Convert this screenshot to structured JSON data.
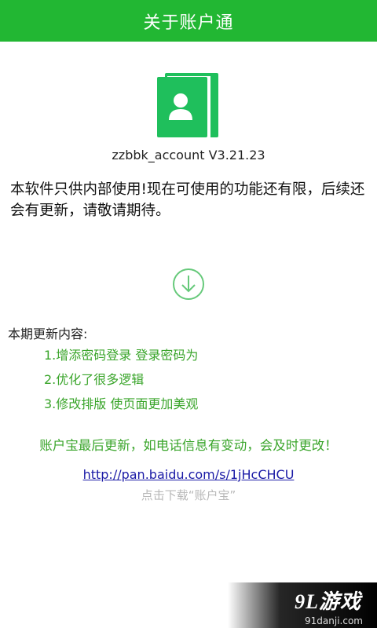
{
  "header": {
    "title": "关于账户通"
  },
  "app": {
    "icon": "contact-card-icon",
    "version": "zzbbk_account V3.21.23"
  },
  "notice": "本软件只供内部使用!现在可使用的功能还有限，后续还会有更新，请敬请期待。",
  "download": {
    "icon": "download-circle-icon"
  },
  "update": {
    "title": "本期更新内容:",
    "items": [
      "1.增添密码登录 登录密码为",
      "2.优化了很多逻辑",
      "3.修改排版 使页面更加美观"
    ]
  },
  "note": "账户宝最后更新，如电话信息有变动，会及时更改！",
  "link": {
    "url": "http://pan.baidu.com/s/1jHcCHCU",
    "caption": "点击下载“账户宝”"
  },
  "watermark": {
    "logo": "9L游戏",
    "url": "91danji.com"
  },
  "colors": {
    "brand_green": "#22b733",
    "text_green": "#3aa52b",
    "link_blue": "#1a1aa6"
  }
}
